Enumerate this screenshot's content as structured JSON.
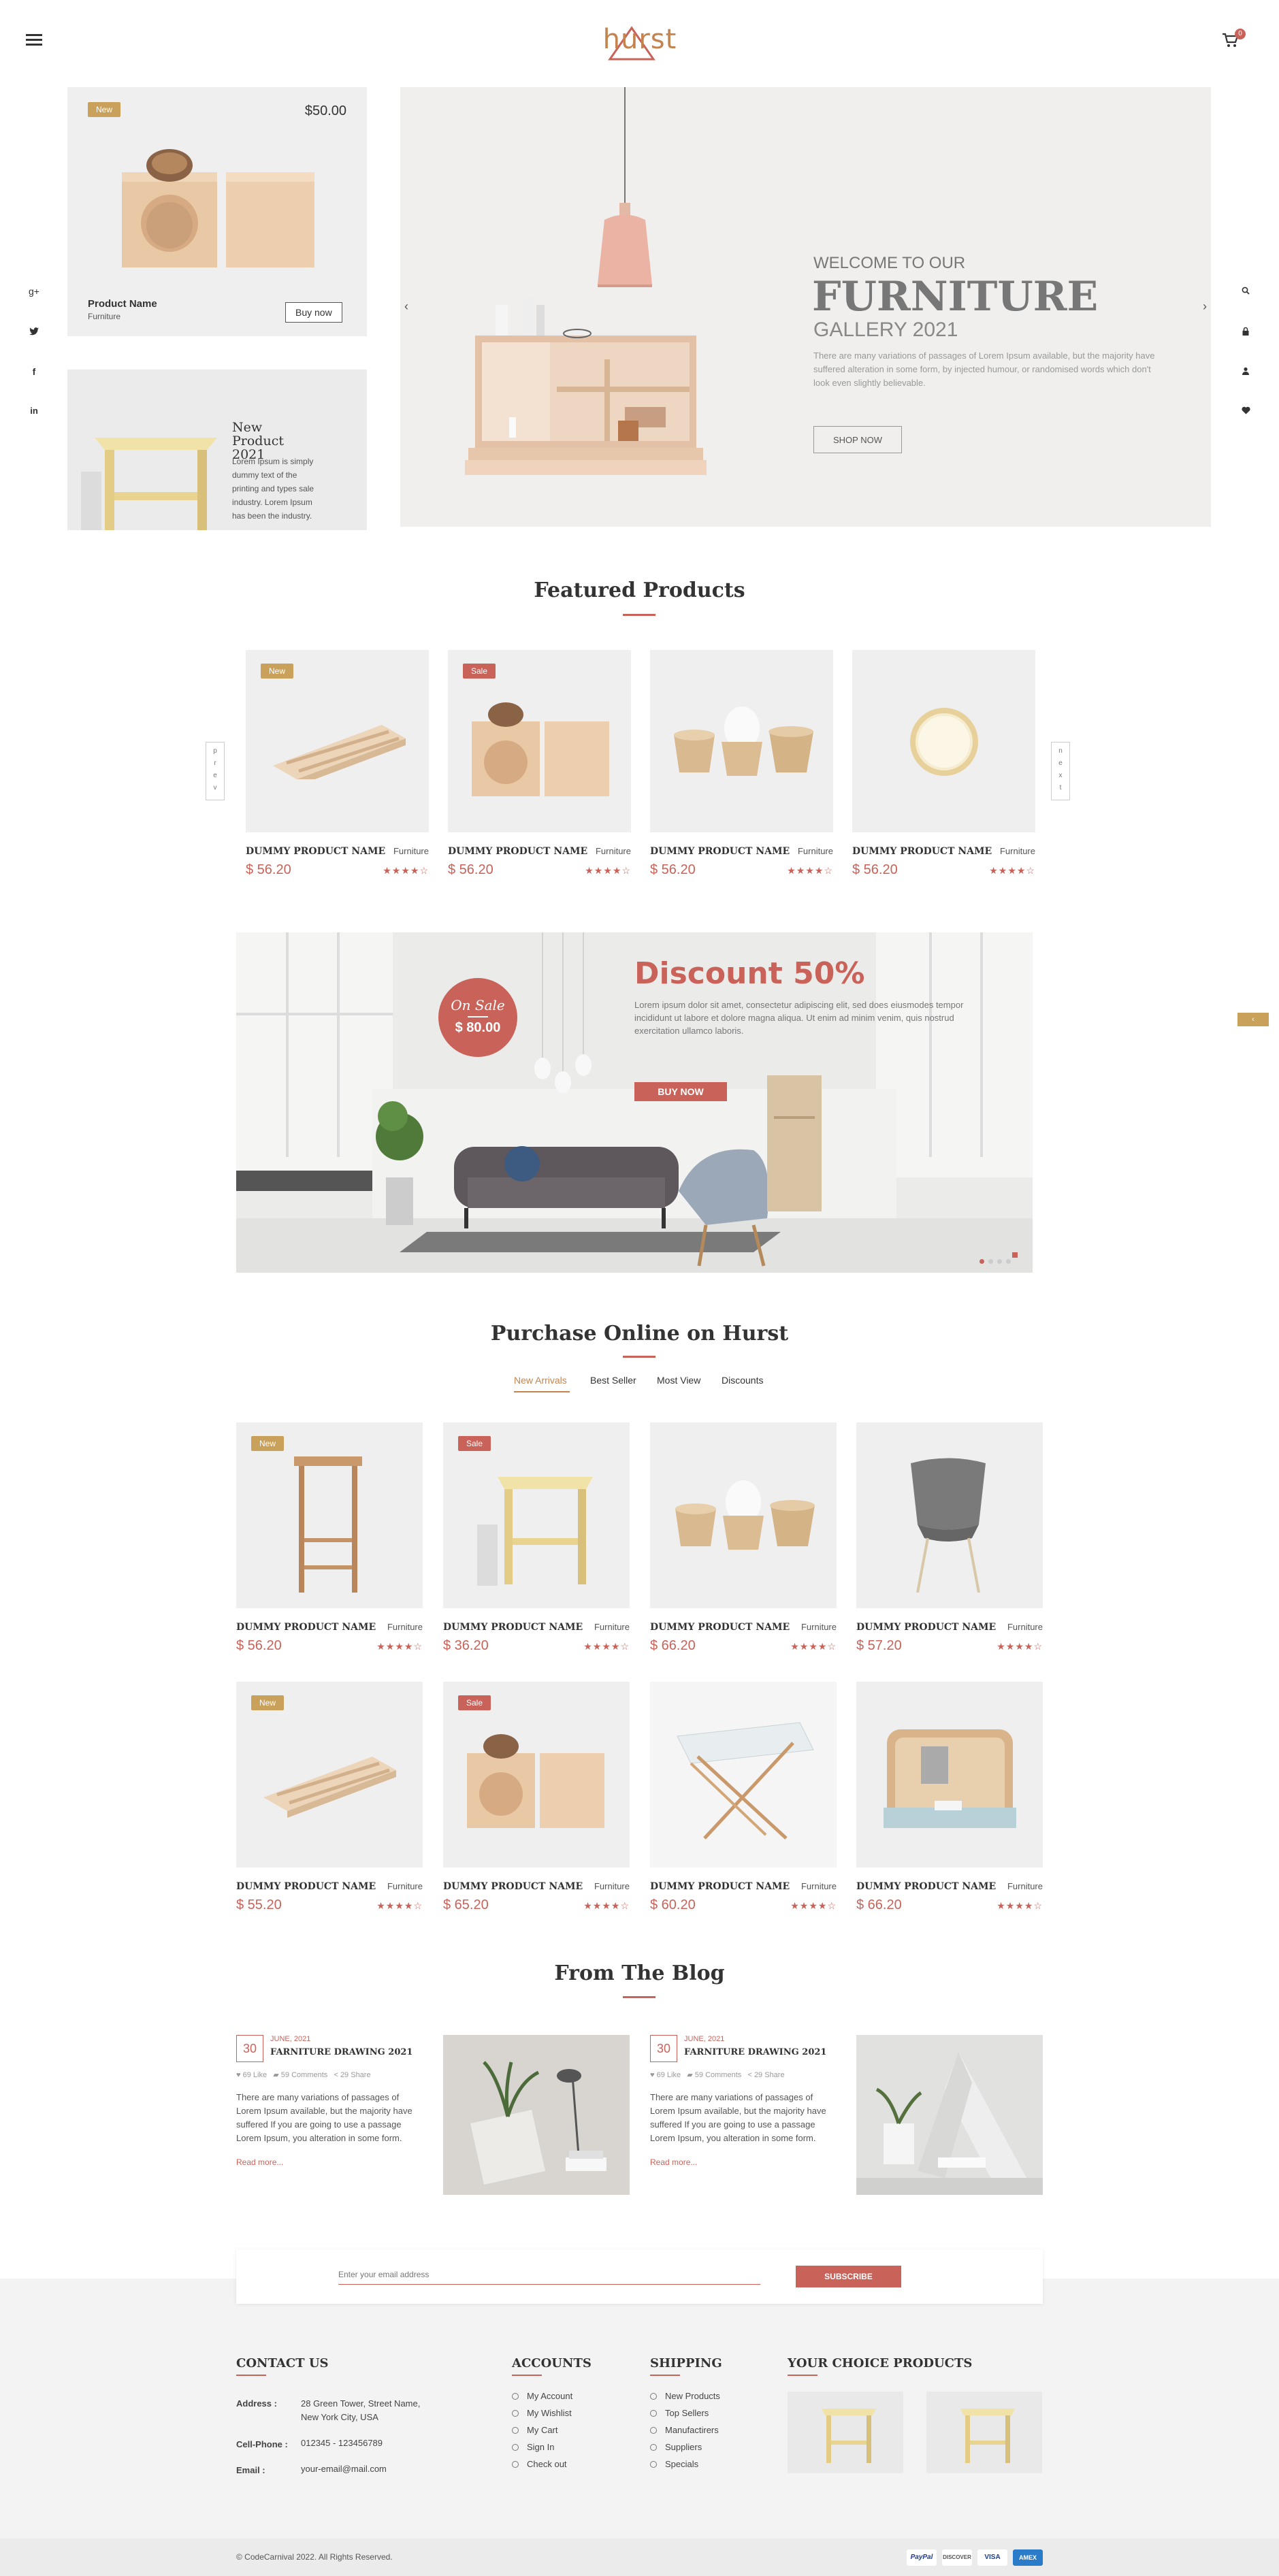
{
  "header": {
    "logo": "hurst",
    "cart_count": "0"
  },
  "hero_left": {
    "card1": {
      "badge": "New",
      "price": "$50.00",
      "name": "Product Name",
      "category": "Furniture",
      "button": "Buy now"
    },
    "card2": {
      "title": "New Product 2021",
      "text": "Lorem Ipsum is simply dummy text of the printing and types sale industry. Lorem Ipsum has been the industry."
    }
  },
  "hero": {
    "welcome": "WELCOME TO OUR",
    "title": "FURNITURE",
    "subtitle": "GALLERY 2021",
    "text": "There are many variations of passages of Lorem Ipsum available, but the majority have suffered alteration in some form, by injected humour, or randomised words which don't look even slightly believable.",
    "button": "SHOP NOW"
  },
  "featured": {
    "title": "Featured Products",
    "prev": [
      "p",
      "r",
      "e",
      "v"
    ],
    "next": [
      "n",
      "e",
      "x",
      "t"
    ],
    "items": [
      {
        "badge": "New",
        "name": "DUMMY PRODUCT NAME",
        "category": "Furniture",
        "price": "$ 56.20",
        "stars": "★★★★☆"
      },
      {
        "badge": "Sale",
        "name": "DUMMY PRODUCT NAME",
        "category": "Furniture",
        "price": "$ 56.20",
        "stars": "★★★★☆"
      },
      {
        "badge": "",
        "name": "DUMMY PRODUCT NAME",
        "category": "Furniture",
        "price": "$ 56.20",
        "stars": "★★★★☆"
      },
      {
        "badge": "",
        "name": "DUMMY PRODUCT NAME",
        "category": "Furniture",
        "price": "$ 56.20",
        "stars": "★★★★☆"
      }
    ]
  },
  "discount": {
    "on_sale": "On Sale",
    "sale_price": "$ 80.00",
    "title": "Discount 50%",
    "text": "Lorem ipsum dolor sit amet, consectetur adipiscing elit, sed does eiusmodes tempor incididunt ut labore et dolore magna aliqua. Ut enim ad minim venim, quis nostrud exercitation ullamco laboris.",
    "button": "BUY NOW"
  },
  "purchase": {
    "title": "Purchase Online on Hurst",
    "tabs": [
      "New Arrivals",
      "Best Seller",
      "Most View",
      "Discounts"
    ],
    "items": [
      {
        "badge": "New",
        "name": "DUMMY PRODUCT NAME",
        "category": "Furniture",
        "price": "$ 56.20",
        "stars": "★★★★☆"
      },
      {
        "badge": "Sale",
        "name": "DUMMY PRODUCT NAME",
        "category": "Furniture",
        "price": "$ 36.20",
        "stars": "★★★★☆"
      },
      {
        "badge": "",
        "name": "DUMMY PRODUCT NAME",
        "category": "Furniture",
        "price": "$ 66.20",
        "stars": "★★★★☆"
      },
      {
        "badge": "",
        "name": "DUMMY PRODUCT NAME",
        "category": "Furniture",
        "price": "$ 57.20",
        "stars": "★★★★☆"
      },
      {
        "badge": "New",
        "name": "DUMMY PRODUCT NAME",
        "category": "Furniture",
        "price": "$ 55.20",
        "stars": "★★★★☆"
      },
      {
        "badge": "Sale",
        "name": "DUMMY PRODUCT NAME",
        "category": "Furniture",
        "price": "$ 65.20",
        "stars": "★★★★☆"
      },
      {
        "badge": "",
        "name": "DUMMY PRODUCT NAME",
        "category": "Furniture",
        "price": "$ 60.20",
        "stars": "★★★★☆"
      },
      {
        "badge": "",
        "name": "DUMMY PRODUCT NAME",
        "category": "Furniture",
        "price": "$ 66.20",
        "stars": "★★★★☆"
      }
    ]
  },
  "blog": {
    "title": "From The Blog",
    "posts": [
      {
        "day": "30",
        "date": "JUNE, 2021",
        "title": "FARNITURE DRAWING 2021",
        "likes": "69 Like",
        "comments": "59 Comments",
        "shares": "29 Share",
        "text": "There are many variations of passages of Lorem Ipsum available, but the majority have suffered If you are going to use a passage Lorem Ipsum, you alteration in some form.",
        "read_more": "Read more..."
      },
      {
        "day": "30",
        "date": "JUNE, 2021",
        "title": "FARNITURE DRAWING 2021",
        "likes": "69 Like",
        "comments": "59 Comments",
        "shares": "29 Share",
        "text": "There are many variations of passages of Lorem Ipsum available, but the majority have suffered If you are going to use a passage Lorem Ipsum, you alteration in some form.",
        "read_more": "Read more..."
      }
    ]
  },
  "newsletter": {
    "placeholder": "Enter your email address",
    "button": "SUBSCRIBE"
  },
  "footer": {
    "contact": {
      "title": "CONTACT US",
      "address_label": "Address :",
      "address": "28 Green Tower, Street Name, New York City, USA",
      "phone_label": "Cell-Phone :",
      "phone": "012345 - 123456789",
      "email_label": "Email :",
      "email": "your-email@mail.com"
    },
    "accounts": {
      "title": "ACCOUNTS",
      "links": [
        "My Account",
        "My Wishlist",
        "My Cart",
        "Sign In",
        "Check out"
      ]
    },
    "shipping": {
      "title": "SHIPPING",
      "links": [
        "New Products",
        "Top Sellers",
        "Manufactirers",
        "Suppliers",
        "Specials"
      ]
    },
    "choice": {
      "title": "YOUR CHOICE PRODUCTS"
    },
    "copyright": "© CodeCarnival 2022. All Rights Reserved.",
    "payments": [
      "PayPal",
      "DISCOVER",
      "VISA",
      "AMEX"
    ]
  },
  "colors": {
    "accent": "#c9635a",
    "gold": "#c9a15a",
    "brand": "#c38450"
  }
}
